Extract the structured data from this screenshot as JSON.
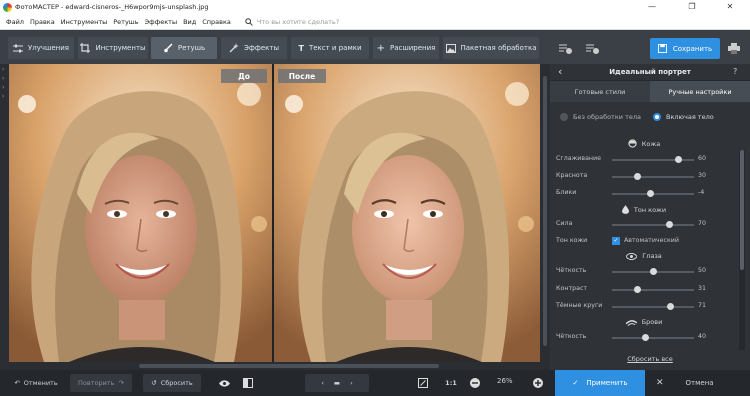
{
  "titlebar": {
    "title": "ФотоМАСТЕР - edward-cisneros-_H6wpor9mjs-unsplash.jpg",
    "minimize": "—",
    "maximize": "❐",
    "close": "✕"
  },
  "menu": {
    "items": [
      "Файл",
      "Правка",
      "Инструменты",
      "Ретушь",
      "Эффекты",
      "Вид",
      "Справка"
    ],
    "search_placeholder": "Что вы хотите сделать?"
  },
  "toolbar": {
    "tabs": [
      "Улучшения",
      "Инструменты",
      "Ретушь",
      "Эффекты",
      "Текст и рамки",
      "Расширения",
      "Пакетная обработка"
    ],
    "active": "Ретушь",
    "save_label": "Сохранить"
  },
  "canvas": {
    "before_label": "До",
    "after_label": "После"
  },
  "panel": {
    "title": "Идеальный портрет",
    "tabs": [
      "Готовые стили",
      "Ручные настройки"
    ],
    "active_tab": "Ручные настройки",
    "radio": {
      "off_label": "Без обработки тела",
      "on_label": "Включая тело"
    },
    "sections": {
      "skin": "Кожа",
      "tone": "Тон кожи",
      "eyes": "Глаза",
      "brows": "Брови"
    },
    "sliders": {
      "smoothing": {
        "label": "Сглаживание",
        "value": "60"
      },
      "redness": {
        "label": "Краснота",
        "value": "30"
      },
      "glare": {
        "label": "Блики",
        "value": "-4"
      },
      "strength": {
        "label": "Сила",
        "value": "70"
      },
      "eye_clarity": {
        "label": "Чёткость",
        "value": "50"
      },
      "contrast": {
        "label": "Контраст",
        "value": "31"
      },
      "dark_circles": {
        "label": "Тёмные круги",
        "value": "71"
      },
      "brow_clarity": {
        "label": "Чёткость",
        "value": "40"
      }
    },
    "skin_tone": {
      "label": "Тон кожи",
      "auto_label": "Автоматический"
    },
    "reset_all": "Сбросить все"
  },
  "bottom": {
    "undo": "Отменить",
    "redo": "Повторить",
    "reset": "Сбросить",
    "zoom_fit": "1:1",
    "zoom": "26%",
    "apply": "Применить",
    "cancel": "Отмена"
  },
  "colors": {
    "accent": "#2f8fe0",
    "toolbar": "#3b4046",
    "panel": "#2f3338"
  }
}
